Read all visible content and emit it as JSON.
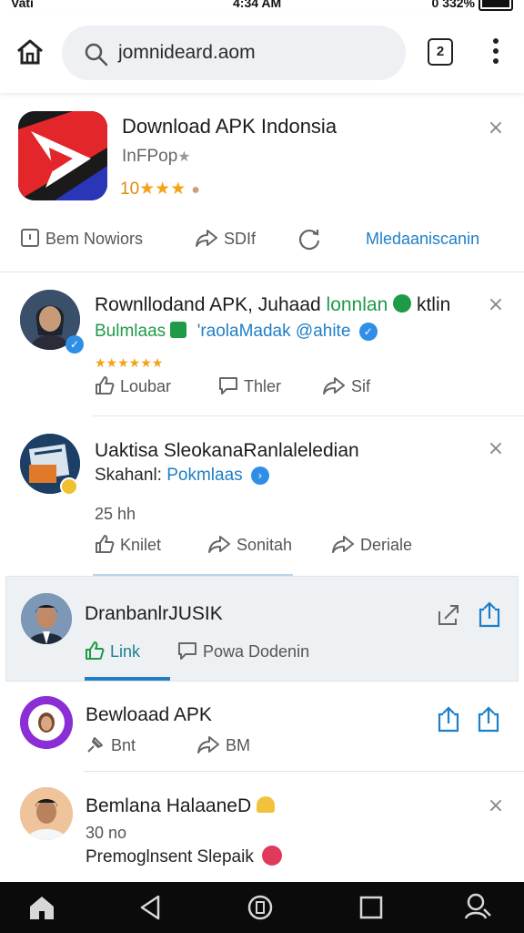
{
  "status_bar": {
    "carrier": "Vati",
    "time": "4:34 AM",
    "battery": "0 332%"
  },
  "browser": {
    "url": "jomnideard.aom",
    "tab_count": "2"
  },
  "app_card": {
    "title": "Download APK Indonsia",
    "publisher": "InFPop",
    "rating": "10",
    "stars": "★★★",
    "actions": {
      "left": "Bem Nowiors",
      "share": "SDIf",
      "right": "Mledaaniscanin"
    }
  },
  "post1": {
    "title": "Rownllodand APK, Juhaad",
    "title_link": "lonnlan",
    "title_end": "ktlin",
    "sub_green": "Bulmlaas",
    "sub_blue": "'raolaMadak @ahite",
    "stars": "★★★★★★",
    "like": "Loubar",
    "comment": "Thler",
    "share": "Sif"
  },
  "post2": {
    "title": "Uaktisa SleokanaRanlaleledian",
    "sub_dark": "Skahanl:",
    "sub_blue": "Pokmlaas",
    "time": "25 hh",
    "like": "Knilet",
    "share": "Sonitah",
    "share2": "Deriale"
  },
  "post3": {
    "title": "DranbanlrJUSIK",
    "like": "Link",
    "comment": "Powa Dodenin"
  },
  "post4": {
    "title": "Bewloaad APK",
    "like": "Bnt",
    "share": "BM"
  },
  "post5": {
    "title": "Bemlana HalaaneD",
    "time": "30 no",
    "text": "Premoglnsent Slepaik"
  },
  "colors": {
    "accent_blue": "#1e7fc8",
    "green": "#1f9a47",
    "star": "#f2a317"
  }
}
